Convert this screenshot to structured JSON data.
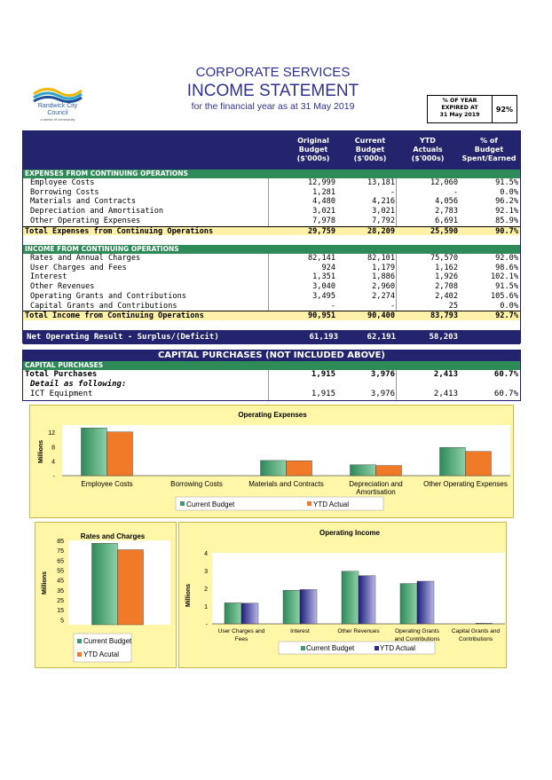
{
  "header": {
    "logo_line1": "Randwick City",
    "logo_line2": "Council",
    "logo_tagline": "a sense of community",
    "department": "CORPORATE SERVICES",
    "title": "INCOME STATEMENT",
    "subtitle": "for the financial year as at 31 May 2019",
    "expired_label": [
      "% OF YEAR",
      "EXPIRED AT",
      "31 May 2019"
    ],
    "expired_value": "92%"
  },
  "columns": [
    [
      "Original",
      "Budget",
      "($'000s)"
    ],
    [
      "Current",
      "Budget",
      "($'000s)"
    ],
    [
      "YTD",
      "Actuals",
      "($'000s)"
    ],
    [
      "% of",
      "Budget",
      "Spent/Earned"
    ]
  ],
  "expenses": {
    "heading": "EXPENSES FROM CONTINUING OPERATIONS",
    "rows": [
      {
        "label": "Employee Costs",
        "orig": "12,999",
        "curr": "13,181",
        "ytd": "12,060",
        "pct": "91.5%"
      },
      {
        "label": "Borrowing Costs",
        "orig": "1,281",
        "curr": "-",
        "ytd": "-",
        "pct": "0.0%"
      },
      {
        "label": "Materials and Contracts",
        "orig": "4,480",
        "curr": "4,216",
        "ytd": "4,056",
        "pct": "96.2%"
      },
      {
        "label": "Depreciation and Amortisation",
        "orig": "3,021",
        "curr": "3,021",
        "ytd": "2,783",
        "pct": "92.1%"
      },
      {
        "label": "Other Operating Expenses",
        "orig": "7,978",
        "curr": "7,792",
        "ytd": "6,691",
        "pct": "85.9%"
      }
    ],
    "total": {
      "label": "Total Expenses from Continuing Operations",
      "orig": "29,759",
      "curr": "28,209",
      "ytd": "25,590",
      "pct": "90.7%"
    }
  },
  "income": {
    "heading": "INCOME FROM CONTINUING OPERATIONS",
    "rows": [
      {
        "label": "Rates and Annual Charges",
        "orig": "82,141",
        "curr": "82,101",
        "ytd": "75,570",
        "pct": "92.0%"
      },
      {
        "label": "User Charges and Fees",
        "orig": "924",
        "curr": "1,179",
        "ytd": "1,162",
        "pct": "98.6%"
      },
      {
        "label": "Interest",
        "orig": "1,351",
        "curr": "1,886",
        "ytd": "1,926",
        "pct": "102.1%"
      },
      {
        "label": "Other Revenues",
        "orig": "3,040",
        "curr": "2,960",
        "ytd": "2,708",
        "pct": "91.5%"
      },
      {
        "label": "Operating Grants and Contributions",
        "orig": "3,495",
        "curr": "2,274",
        "ytd": "2,402",
        "pct": "105.6%"
      },
      {
        "label": "Capital Grants and Contributions",
        "orig": "-",
        "curr": "-",
        "ytd": "25",
        "pct": "0.0%"
      }
    ],
    "total": {
      "label": "Total Income from Continuing Operations",
      "orig": "90,951",
      "curr": "90,400",
      "ytd": "83,793",
      "pct": "92.7%"
    }
  },
  "net": {
    "label": "Net Operating Result - Surplus/(Deficit)",
    "orig": "61,193",
    "curr": "62,191",
    "ytd": "58,203"
  },
  "capital": {
    "heading": "CAPITAL PURCHASES (NOT INCLUDED ABOVE)",
    "band": "CAPITAL PURCHASES",
    "total": {
      "label": "Total Purchases",
      "orig": "1,915",
      "curr": "3,976",
      "ytd": "2,413",
      "pct": "60.7%"
    },
    "detail_label": "Detail as following:",
    "item": {
      "label": "ICT Equipment",
      "orig": "1,915",
      "curr": "3,976",
      "ytd": "2,413",
      "pct": "60.7%"
    }
  },
  "colors": {
    "current_budget": "#3a9a6a",
    "ytd_actual": "#f07a28",
    "navy": "#24246e",
    "green_band": "#2e8b57",
    "panel": "#fff6a8",
    "income_ytd": "#2b2b8a"
  },
  "chart_data": [
    {
      "type": "bar",
      "title": "Operating Expenses",
      "ylabel": "Millions",
      "categories": [
        "Employee Costs",
        "Borrowing Costs",
        "Materials and Contracts",
        "Depreciation and Amortisation",
        "Other Operating Expenses"
      ],
      "yticks": [
        "12",
        "8",
        "4",
        "-"
      ],
      "ylim": [
        0,
        14
      ],
      "series": [
        {
          "name": "Current Budget",
          "values": [
            13.2,
            0,
            4.2,
            3.0,
            7.8
          ]
        },
        {
          "name": "YTD Actual",
          "values": [
            12.1,
            0,
            4.1,
            2.8,
            6.7
          ]
        }
      ],
      "legend": "bottom"
    },
    {
      "type": "bar",
      "title": "Rates and Charges",
      "ylabel": "Millions",
      "categories": [
        ""
      ],
      "yticks": [
        "85",
        "75",
        "65",
        "55",
        "45",
        "35",
        "25",
        "15",
        "5"
      ],
      "ylim": [
        0,
        85
      ],
      "series": [
        {
          "name": "Current Budget",
          "values": [
            82.1
          ]
        },
        {
          "name": "YTD Acutal",
          "values": [
            75.6
          ]
        }
      ],
      "legend": "bottom-left"
    },
    {
      "type": "bar",
      "title": "Operating Income",
      "ylabel": "Millions",
      "categories": [
        "User Charges and Fees",
        "Interest",
        "Other Revenues",
        "Operating Grants and Contributions",
        "Capital Grants and Contributions"
      ],
      "yticks": [
        "4",
        "3",
        "2",
        "1",
        "-"
      ],
      "ylim": [
        0,
        4
      ],
      "series": [
        {
          "name": "Current Budget",
          "values": [
            1.18,
            1.89,
            2.96,
            2.27,
            0
          ]
        },
        {
          "name": "YTD Actual",
          "values": [
            1.16,
            1.93,
            2.71,
            2.4,
            0.03
          ]
        }
      ],
      "legend": "bottom"
    }
  ]
}
